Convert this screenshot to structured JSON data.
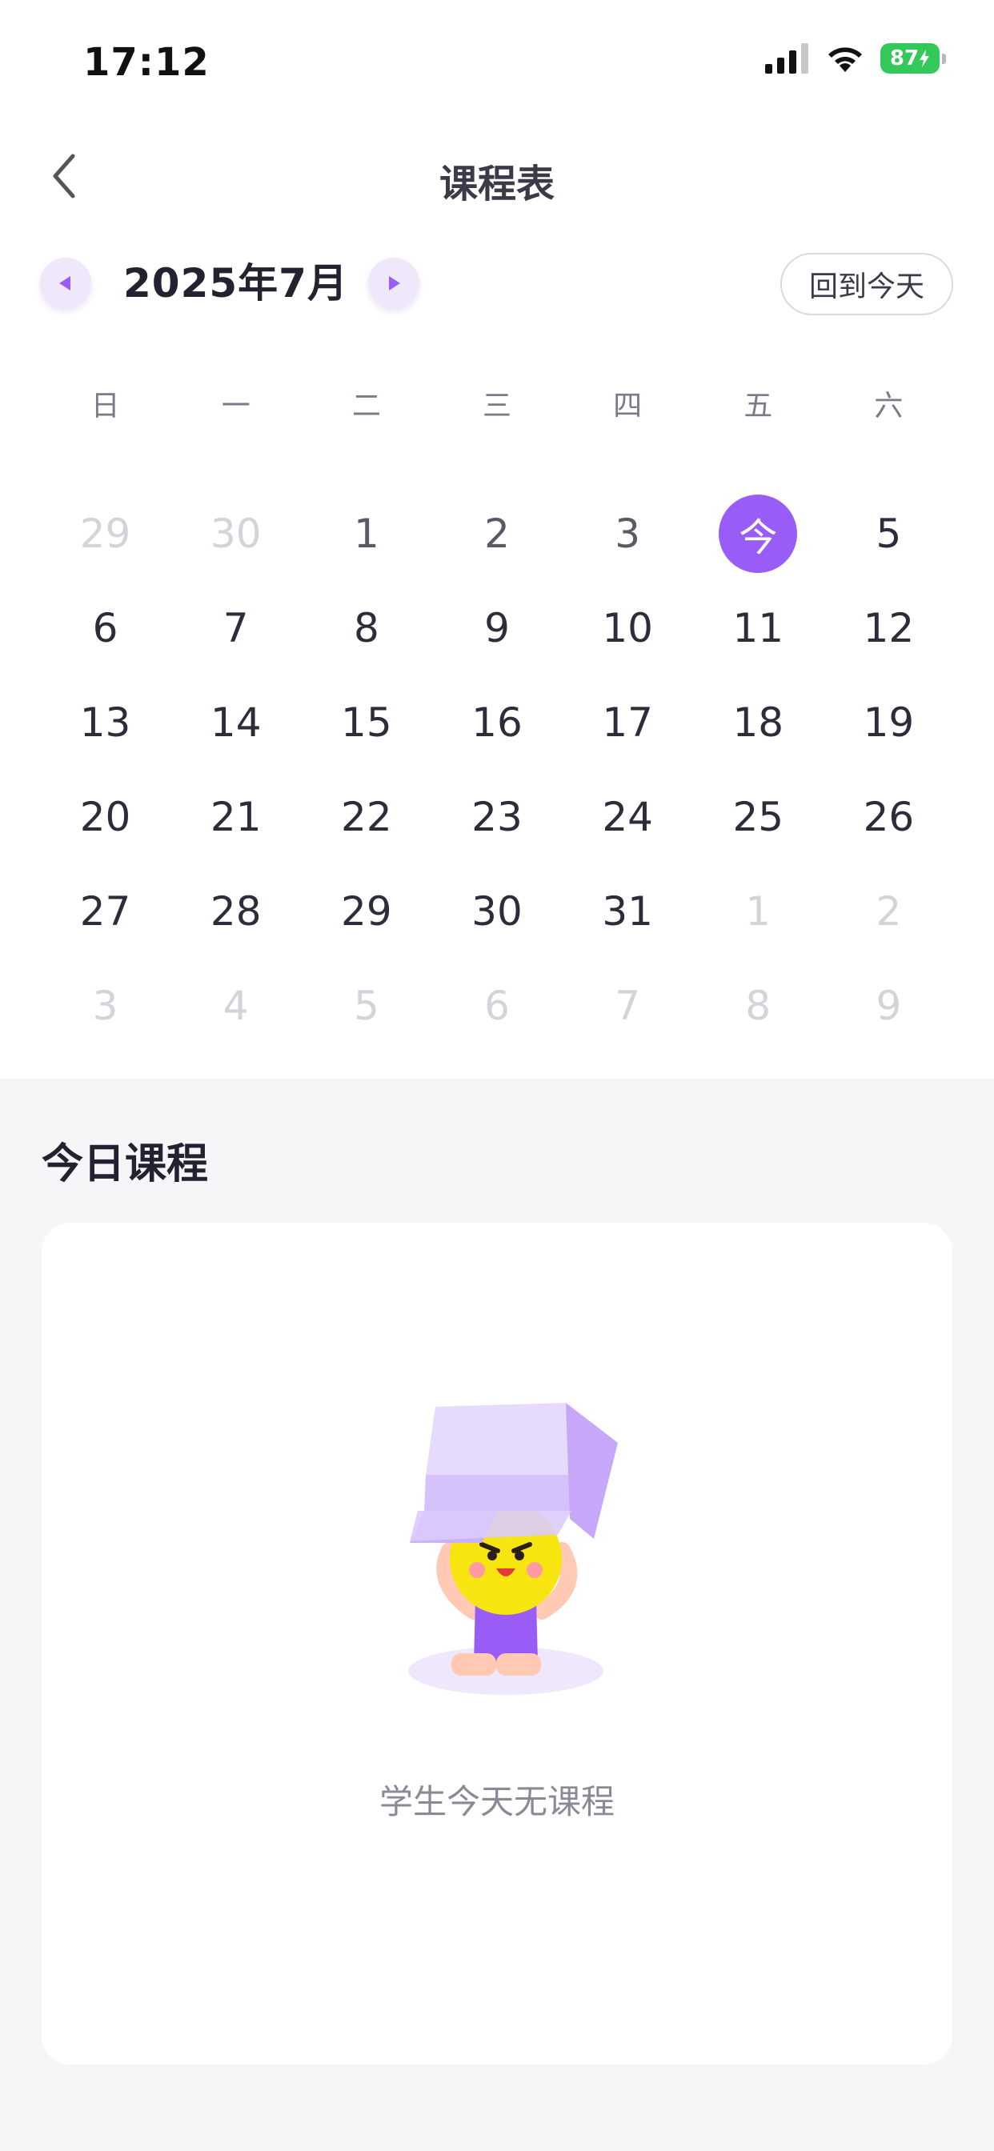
{
  "status_bar": {
    "time": "17:12",
    "battery": "87"
  },
  "nav": {
    "title": "课程表"
  },
  "month_bar": {
    "label": "2025年7月",
    "today_button": "回到今天"
  },
  "calendar": {
    "weekdays": [
      "日",
      "一",
      "二",
      "三",
      "四",
      "五",
      "六"
    ],
    "weeks": [
      [
        {
          "t": "29",
          "s": "muted"
        },
        {
          "t": "30",
          "s": "muted"
        },
        {
          "t": "1",
          "s": "past"
        },
        {
          "t": "2",
          "s": "past"
        },
        {
          "t": "3",
          "s": "past"
        },
        {
          "t": "今",
          "s": "today"
        },
        {
          "t": "5",
          "s": "normal"
        }
      ],
      [
        {
          "t": "6",
          "s": "normal"
        },
        {
          "t": "7",
          "s": "normal"
        },
        {
          "t": "8",
          "s": "normal"
        },
        {
          "t": "9",
          "s": "normal"
        },
        {
          "t": "10",
          "s": "normal"
        },
        {
          "t": "11",
          "s": "normal"
        },
        {
          "t": "12",
          "s": "normal"
        }
      ],
      [
        {
          "t": "13",
          "s": "normal"
        },
        {
          "t": "14",
          "s": "normal"
        },
        {
          "t": "15",
          "s": "normal"
        },
        {
          "t": "16",
          "s": "normal"
        },
        {
          "t": "17",
          "s": "normal"
        },
        {
          "t": "18",
          "s": "normal"
        },
        {
          "t": "19",
          "s": "normal"
        }
      ],
      [
        {
          "t": "20",
          "s": "normal"
        },
        {
          "t": "21",
          "s": "normal"
        },
        {
          "t": "22",
          "s": "normal"
        },
        {
          "t": "23",
          "s": "normal"
        },
        {
          "t": "24",
          "s": "normal"
        },
        {
          "t": "25",
          "s": "normal"
        },
        {
          "t": "26",
          "s": "normal"
        }
      ],
      [
        {
          "t": "27",
          "s": "normal"
        },
        {
          "t": "28",
          "s": "normal"
        },
        {
          "t": "29",
          "s": "normal"
        },
        {
          "t": "30",
          "s": "normal"
        },
        {
          "t": "31",
          "s": "normal"
        },
        {
          "t": "1",
          "s": "muted"
        },
        {
          "t": "2",
          "s": "muted"
        }
      ],
      [
        {
          "t": "3",
          "s": "muted"
        },
        {
          "t": "4",
          "s": "muted"
        },
        {
          "t": "5",
          "s": "muted"
        },
        {
          "t": "6",
          "s": "muted"
        },
        {
          "t": "7",
          "s": "muted"
        },
        {
          "t": "8",
          "s": "muted"
        },
        {
          "t": "9",
          "s": "muted"
        }
      ]
    ],
    "accent_color": "#9a5cf6"
  },
  "today_section": {
    "title": "今日课程",
    "empty_text": "学生今天无课程",
    "illustration": "empty-box-character"
  },
  "icons": {
    "back": "chevron-left-icon",
    "prev": "triangle-left-icon",
    "next": "triangle-right-icon",
    "signal": "cellular-signal-icon",
    "wifi": "wifi-icon",
    "battery": "battery-charging-icon"
  }
}
